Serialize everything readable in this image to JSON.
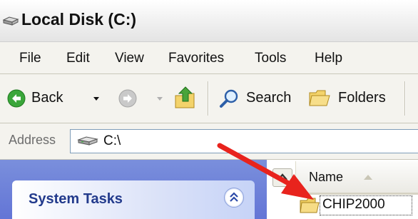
{
  "window": {
    "title": "Local Disk (C:)"
  },
  "menu": {
    "items": [
      "File",
      "Edit",
      "View",
      "Favorites",
      "Tools",
      "Help"
    ]
  },
  "toolbar": {
    "back_label": "Back",
    "search_label": "Search",
    "folders_label": "Folders"
  },
  "address": {
    "label": "Address",
    "value": "C:\\"
  },
  "task_pane": {
    "title": "System Tasks"
  },
  "file_list": {
    "columns": [
      "Name"
    ],
    "items": [
      {
        "name": "CHIP2000",
        "type": "folder"
      }
    ]
  },
  "annotation": {
    "arrow_color": "#e8231d"
  }
}
